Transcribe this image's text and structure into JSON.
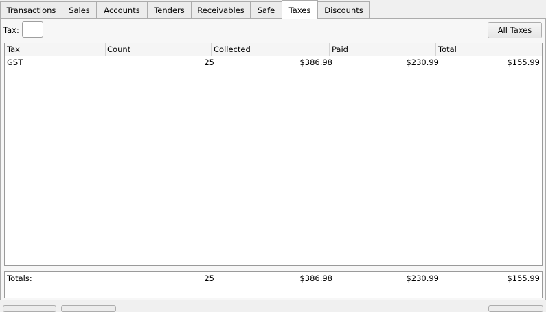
{
  "tabs": [
    "Transactions",
    "Sales",
    "Accounts",
    "Tenders",
    "Receivables",
    "Safe",
    "Taxes",
    "Discounts"
  ],
  "active_tab": "Taxes",
  "filter": {
    "label": "Tax:",
    "value": ""
  },
  "all_taxes_label": "All Taxes",
  "table": {
    "columns": [
      "Tax",
      "Count",
      "Collected",
      "Paid",
      "Total"
    ],
    "rows": [
      {
        "tax": "GST",
        "count": "25",
        "collected": "$386.98",
        "paid": "$230.99",
        "total": "$155.99"
      }
    ]
  },
  "totals": {
    "label": "Totals:",
    "count": "25",
    "collected": "$386.98",
    "paid": "$230.99",
    "total": "$155.99"
  }
}
